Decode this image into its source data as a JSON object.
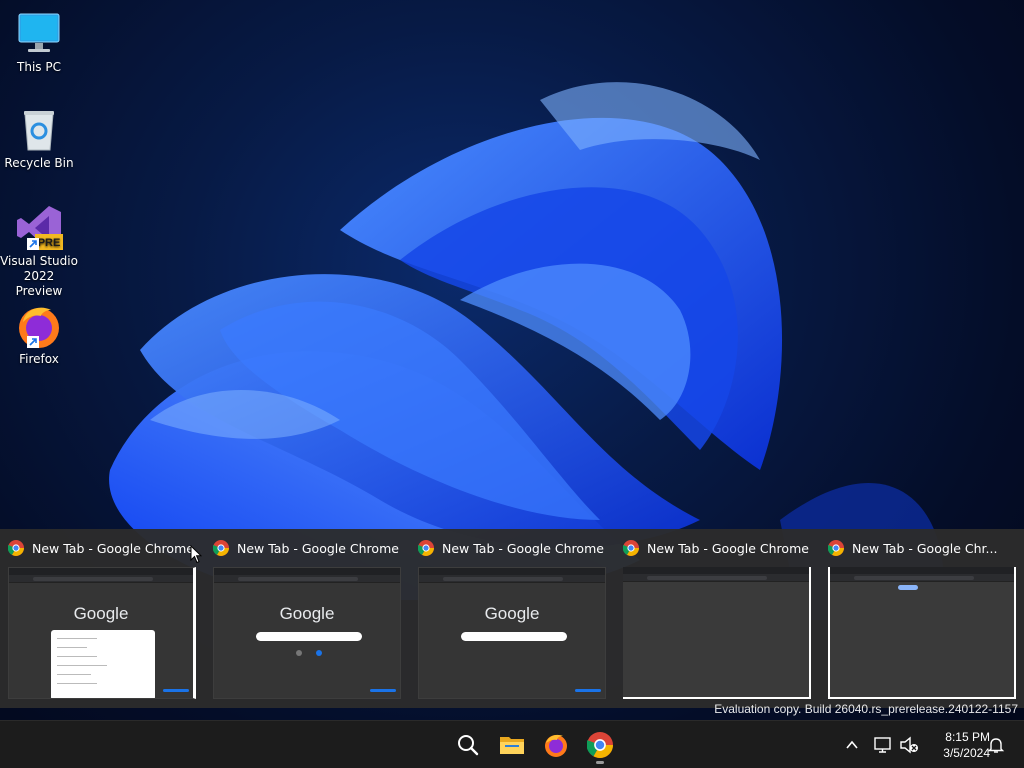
{
  "desktop": {
    "icons": [
      {
        "label": "This PC",
        "icon": "monitor-icon"
      },
      {
        "label": "Recycle Bin",
        "icon": "recycle-bin-icon"
      },
      {
        "label": "Visual Studio 2022 Preview",
        "icon": "visual-studio-icon",
        "badge": "PRE"
      },
      {
        "label": "Firefox",
        "icon": "firefox-icon"
      }
    ]
  },
  "thumbnails": {
    "items": [
      {
        "title": "New Tab - Google Chrome",
        "preview_text": "Google"
      },
      {
        "title": "New Tab - Google Chrome",
        "preview_text": "Google"
      },
      {
        "title": "New Tab - Google Chrome",
        "preview_text": "Google"
      },
      {
        "title": "New Tab - Google Chrome"
      },
      {
        "title": "New Tab - Google Chr..."
      }
    ]
  },
  "watermark": "Evaluation copy. Build 26040.rs_prerelease.240122-1157",
  "taskbar": {
    "apps": [
      {
        "name": "search-icon"
      },
      {
        "name": "file-explorer-icon"
      },
      {
        "name": "firefox-icon"
      },
      {
        "name": "chrome-icon",
        "active": true
      }
    ],
    "tray": {
      "icons": [
        "chevron-up-icon",
        "network-icon",
        "volume-muted-icon"
      ],
      "time": "8:15 PM",
      "date": "3/5/2024",
      "notification_icon": "bell-icon"
    }
  },
  "colors": {
    "accent": "#1a73e8",
    "taskbar": "#1c1c1c",
    "thumbnail_strip": "#2c2c2c"
  }
}
